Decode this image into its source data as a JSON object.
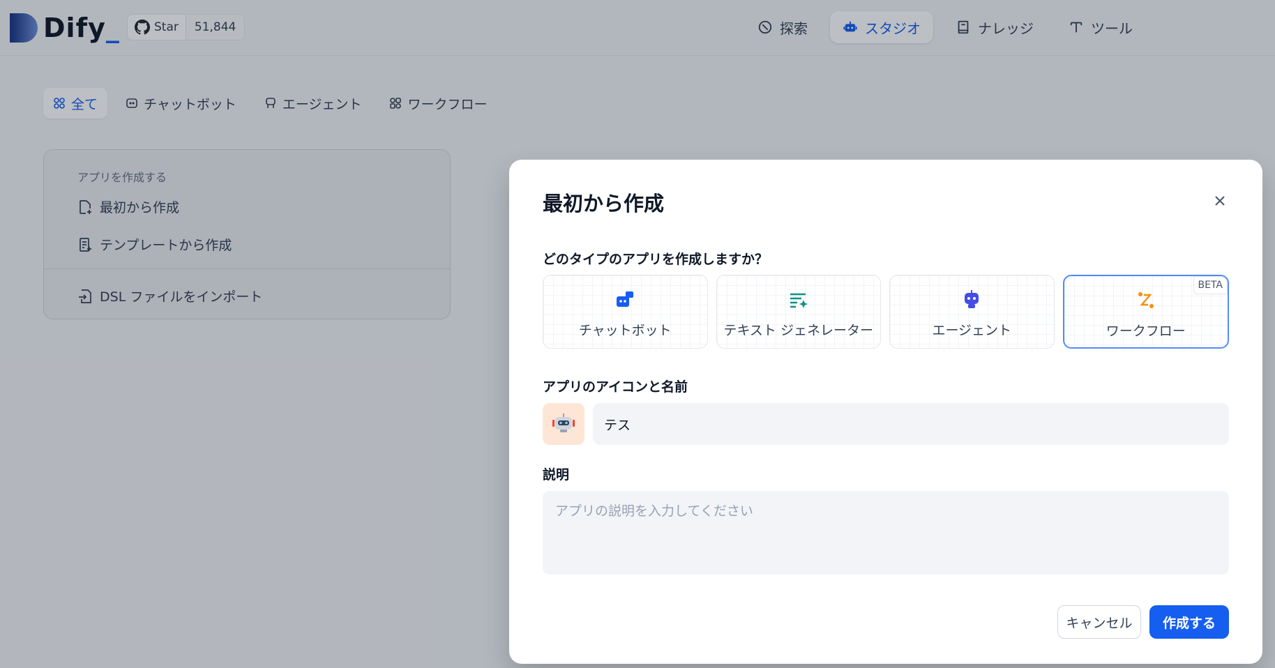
{
  "app": {
    "logo_text": "Dify",
    "logo_dot": "_"
  },
  "github": {
    "star_label": "Star",
    "star_count": "51,844"
  },
  "nav": [
    {
      "label": "探索",
      "icon": "compass-icon"
    },
    {
      "label": "スタジオ",
      "icon": "robot-icon",
      "active": true
    },
    {
      "label": "ナレッジ",
      "icon": "book-icon"
    },
    {
      "label": "ツール",
      "icon": "tool-icon"
    }
  ],
  "filters": [
    {
      "label": "全て",
      "active": true
    },
    {
      "label": "チャットボット"
    },
    {
      "label": "エージェント"
    },
    {
      "label": "ワークフロー"
    }
  ],
  "create_card": {
    "caption": "アプリを作成する",
    "blank": "最初から作成",
    "template": "テンプレートから作成",
    "import": "DSL ファイルをインポート"
  },
  "modal": {
    "title": "最初から作成",
    "question": "どのタイプのアプリを作成しますか？",
    "types": [
      {
        "label": "チャットボット",
        "icon": "chatbot-icon",
        "color": "#155eef"
      },
      {
        "label": "テキスト ジェネレーター",
        "icon": "text-generator-icon",
        "color": "#0e9384"
      },
      {
        "label": "エージェント",
        "icon": "agent-icon",
        "color": "#444ce7"
      },
      {
        "label": "ワークフロー",
        "icon": "workflow-icon",
        "color": "#f79009",
        "badge": "BETA",
        "selected": true
      }
    ],
    "name_label": "アプリのアイコンと名前",
    "name_value": "テス",
    "desc_label": "説明",
    "desc_placeholder": "アプリの説明を入力してください",
    "cancel": "キャンセル",
    "create": "作成する"
  }
}
